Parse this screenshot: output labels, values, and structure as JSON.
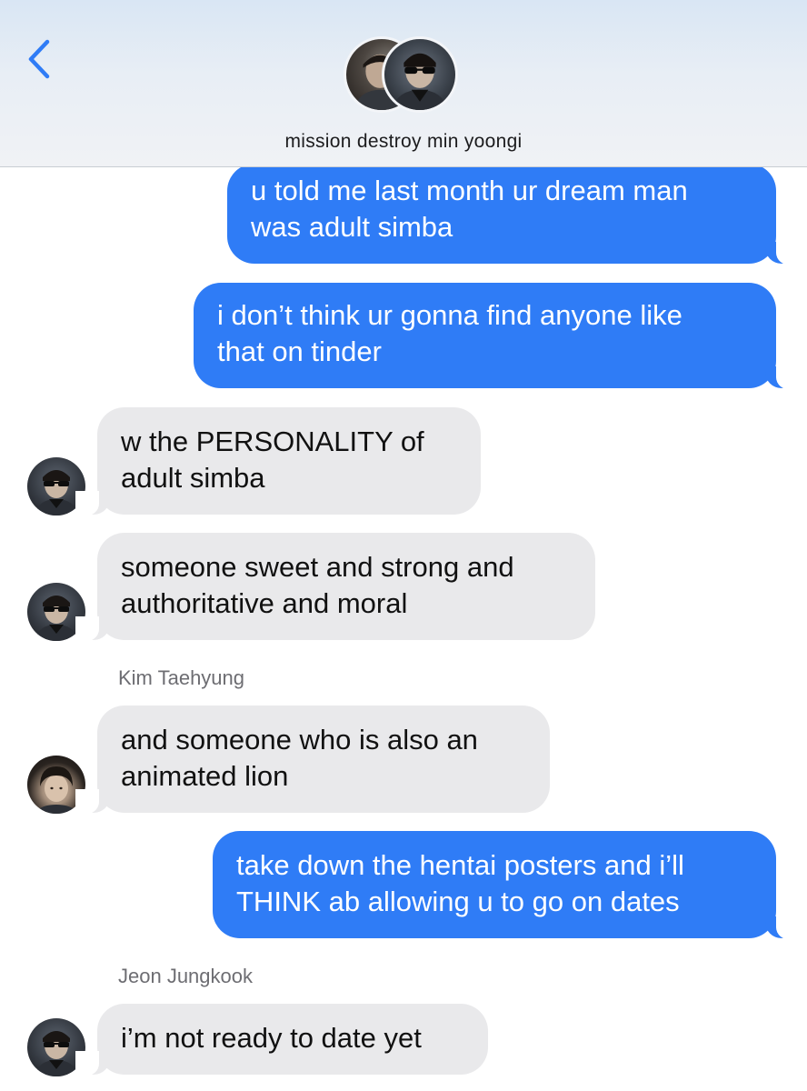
{
  "header": {
    "back_icon": "chevron-left-icon",
    "chat_title": "mission destroy min yoongi",
    "accent_color": "#2f7cf6"
  },
  "messages": [
    {
      "direction": "outgoing",
      "lines": [
        "u told me last month ur dream man",
        "was adult simba"
      ]
    },
    {
      "direction": "outgoing",
      "lines": [
        "i don’t think ur gonna find anyone like",
        "that on tinder"
      ]
    },
    {
      "direction": "incoming",
      "avatar": "sunglasses-avatar",
      "lines": [
        "w the PERSONALITY of",
        "adult simba"
      ]
    },
    {
      "direction": "incoming",
      "avatar": "sunglasses-avatar",
      "lines": [
        "someone sweet and strong and",
        "authoritative and moral"
      ]
    },
    {
      "direction": "incoming",
      "sender": "Kim Taehyung",
      "avatar": "hair-avatar",
      "lines": [
        "and someone who is also an",
        "animated lion"
      ]
    },
    {
      "direction": "outgoing",
      "lines": [
        "take down the hentai posters and i’ll",
        "THINK ab allowing u to go on dates"
      ]
    },
    {
      "direction": "incoming",
      "sender": "Jeon Jungkook",
      "avatar": "sunglasses-avatar",
      "lines": [
        "i’m not ready to date yet"
      ]
    }
  ],
  "colors": {
    "outgoing_bubble": "#2f7cf6",
    "incoming_bubble": "#e9e9eb",
    "sender_name": "#6d6d72"
  }
}
